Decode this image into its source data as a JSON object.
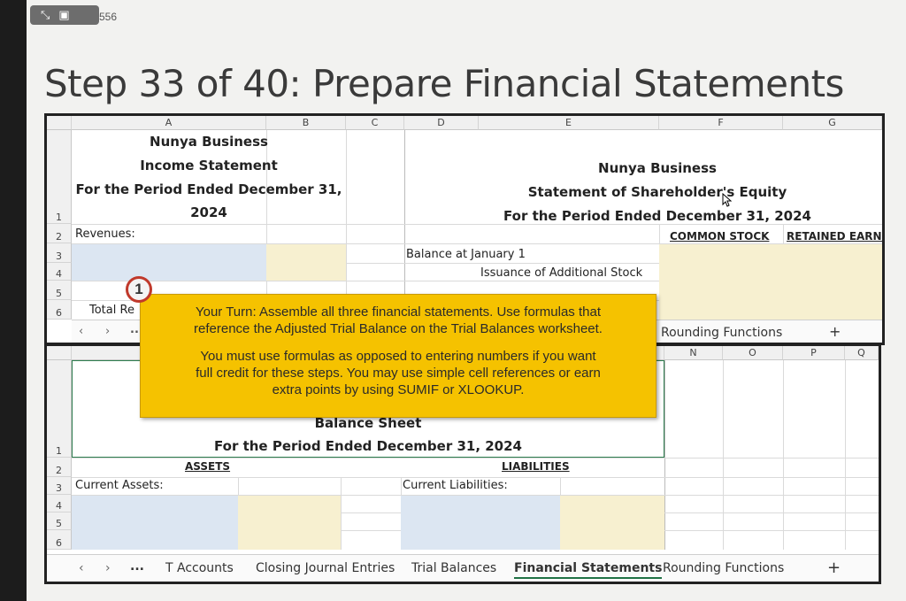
{
  "slide_number": "556",
  "title": "Step 33 of 40: Prepare Financial Statements",
  "top_sheet": {
    "columns": [
      "A",
      "B",
      "C",
      "D",
      "E",
      "F",
      "G"
    ],
    "rows": [
      "1",
      "2",
      "3",
      "4",
      "5",
      "6"
    ],
    "income_statement": {
      "company": "Nunya Business",
      "name": "Income Statement",
      "period_line1": "For the Period Ended December 31,",
      "period_line2": "2024",
      "revenues": "Revenues:",
      "total": "Total Re"
    },
    "equity_statement": {
      "company": "Nunya Business",
      "name": "Statement of Shareholder's Equity",
      "period": "For the Period Ended December 31, 2024",
      "col_common": "COMMON STOCK",
      "col_retained": "RETAINED EARNI",
      "balance_jan": "Balance at January 1",
      "issuance": "Issuance of Additional Stock"
    },
    "tab_partial": "Rounding Functions",
    "nav_ellipsis": "..."
  },
  "bottom_sheet": {
    "columns": [
      "N",
      "O",
      "P",
      "Q"
    ],
    "rows": [
      "1",
      "2",
      "3",
      "4",
      "5",
      "6"
    ],
    "title_partial": "Balance Sheet",
    "period": "For the Period Ended December 31, 2024",
    "assets": "ASSETS",
    "liabilities": "LIABILITIES",
    "current_assets": "Current Assets:",
    "current_liabilities": "Current Liabilities:"
  },
  "tabs": {
    "more": "...",
    "items": [
      "T Accounts",
      "Closing Journal Entries",
      "Trial Balances",
      "Financial Statements",
      "Rounding Functions"
    ],
    "active": "Financial Statements",
    "add": "+"
  },
  "callout": {
    "badge": "1",
    "para1_line1": "Your Turn: Assemble all three financial statements. Use formulas that",
    "para1_line2": "reference the Adjusted Trial Balance on the Trial Balances worksheet.",
    "para2_line1": "You must use formulas as opposed to entering numbers if you want",
    "para2_line2": "full credit for these steps. You may use simple cell references or earn",
    "para2_line3": "extra points by using SUMIF or XLOOKUP."
  },
  "colors": {
    "callout": "#f5c200",
    "active_tab": "#207245",
    "input_blue": "#dce6f2",
    "input_tan": "#f7f0d0"
  }
}
